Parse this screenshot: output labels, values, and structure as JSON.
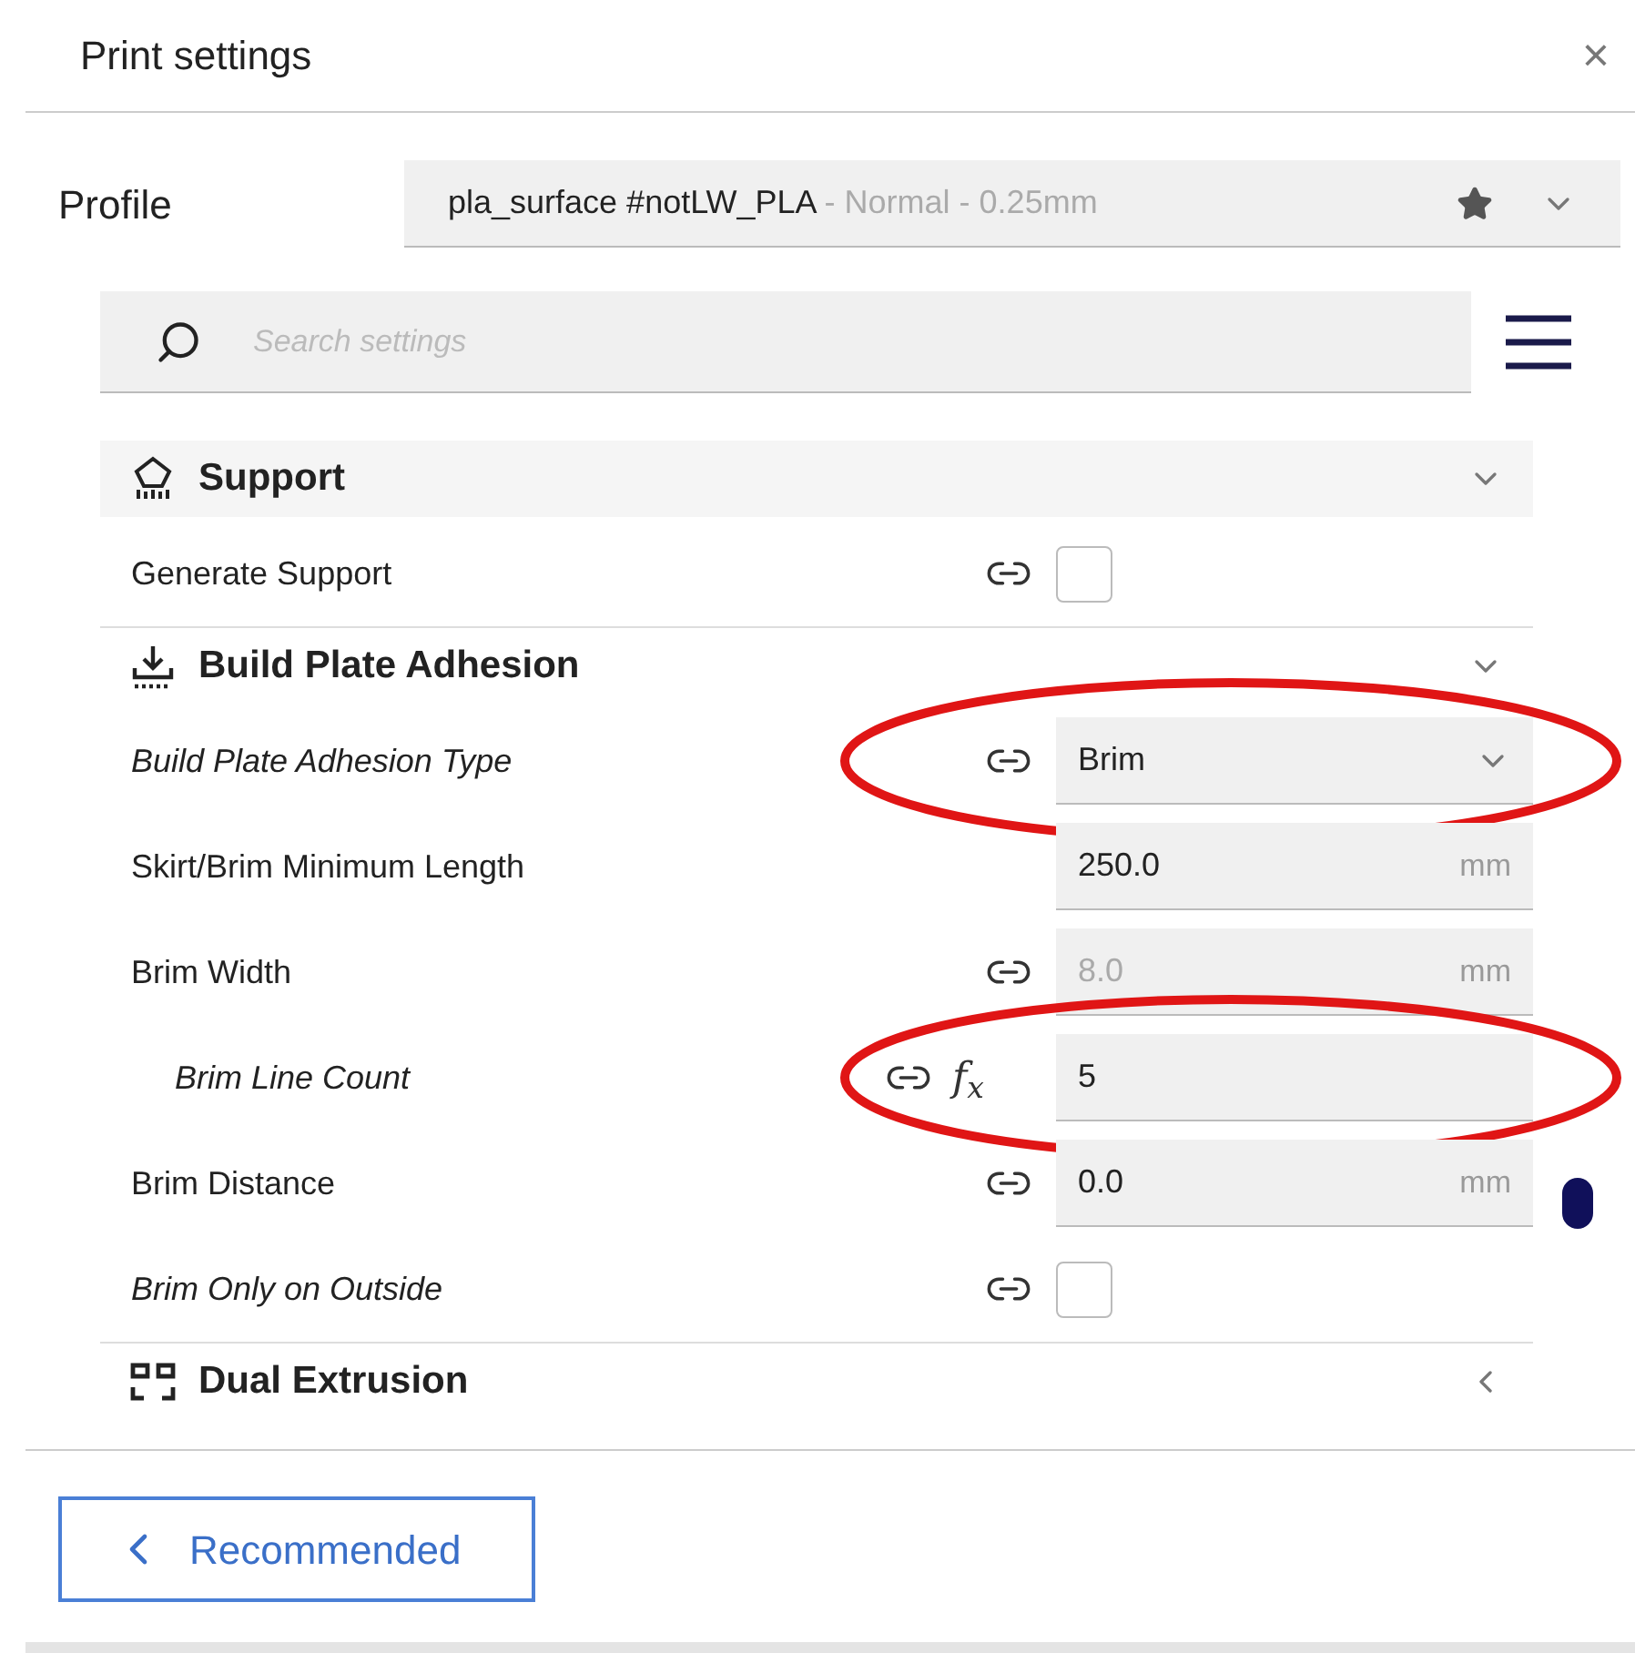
{
  "window": {
    "title": "Print settings",
    "close": "×"
  },
  "profile": {
    "label": "Profile",
    "name": "pla_surface #notLW_PLA",
    "detail": " - Normal - 0.25mm",
    "favorite": true
  },
  "search": {
    "placeholder": "Search settings"
  },
  "sections": [
    {
      "kind": "support",
      "title": "Support",
      "expanded": true,
      "rows": [
        {
          "label": "Generate Support",
          "kind": "checkbox",
          "italic": false,
          "indented": false,
          "linked": true,
          "checked": false,
          "highlighted": false
        }
      ]
    },
    {
      "kind": "adhesion",
      "title": "Build Plate Adhesion",
      "expanded": true,
      "rows": [
        {
          "label": "Build Plate Adhesion Type",
          "kind": "dropdown",
          "italic": true,
          "indented": false,
          "linked": true,
          "value": "Brim",
          "highlighted": true
        },
        {
          "label": "Skirt/Brim Minimum Length",
          "kind": "number",
          "italic": false,
          "indented": false,
          "linked": false,
          "value": "250.0",
          "unit": "mm",
          "disabled": false,
          "highlighted": false
        },
        {
          "label": "Brim Width",
          "kind": "number",
          "italic": false,
          "indented": false,
          "linked": true,
          "value": "8.0",
          "unit": "mm",
          "disabled": true,
          "highlighted": false
        },
        {
          "label": "Brim Line Count",
          "kind": "number",
          "italic": true,
          "indented": true,
          "linked": true,
          "formula": "f$_{x}$",
          "value": "5",
          "disabled": false,
          "highlighted": true
        },
        {
          "label": "Brim Distance",
          "kind": "number",
          "italic": false,
          "indented": false,
          "linked": true,
          "value": "0.0",
          "unit": "mm",
          "disabled": false,
          "highlighted": false
        },
        {
          "label": "Brim Only on Outside",
          "kind": "checkbox",
          "italic": true,
          "indented": false,
          "linked": true,
          "checked": false,
          "highlighted": false
        }
      ]
    },
    {
      "kind": "dual",
      "title": "Dual Extrusion",
      "expanded": false
    }
  ],
  "footer": {
    "button": "Recommended"
  }
}
